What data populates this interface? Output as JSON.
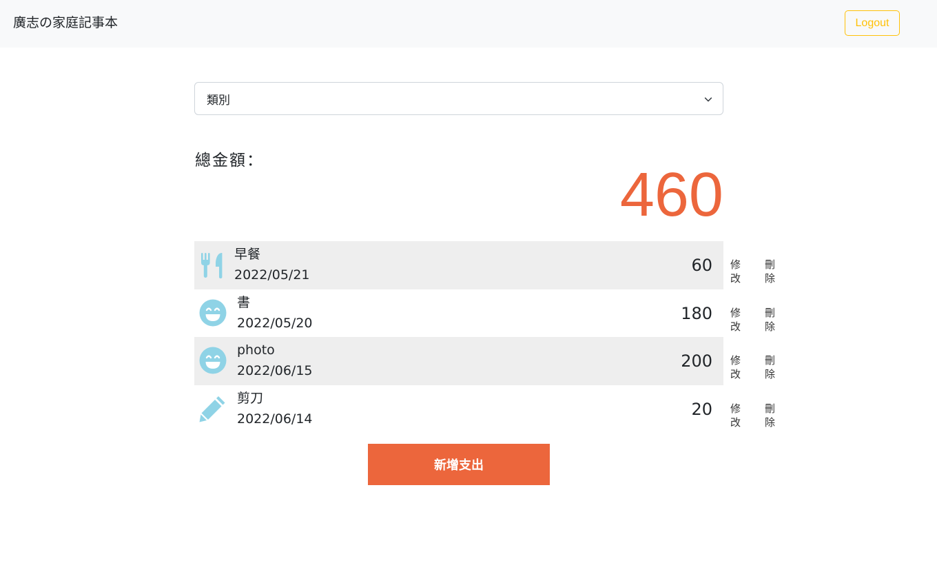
{
  "navbar": {
    "brand": "廣志の家庭記事本",
    "logout_label": "Logout"
  },
  "filter": {
    "category_selected": "類別"
  },
  "total": {
    "label": "總金額：",
    "value": "460"
  },
  "records": [
    {
      "icon": "utensils-icon",
      "name": "早餐",
      "date": "2022/05/21",
      "amount": "60",
      "edit": "修改",
      "delete": "刪除"
    },
    {
      "icon": "smile-icon",
      "name": "書",
      "date": "2022/05/20",
      "amount": "180",
      "edit": "修改",
      "delete": "刪除"
    },
    {
      "icon": "smile-icon",
      "name": "photo",
      "date": "2022/06/15",
      "amount": "200",
      "edit": "修改",
      "delete": "刪除"
    },
    {
      "icon": "pencil-icon",
      "name": "剪刀",
      "date": "2022/06/14",
      "amount": "20",
      "edit": "修改",
      "delete": "刪除"
    }
  ],
  "add_button_label": "新增支出",
  "colors": {
    "accent": "#ec663c",
    "icon": "#8fd3e6",
    "logout": "#ffc107",
    "row_shade": "#eeeeee"
  }
}
